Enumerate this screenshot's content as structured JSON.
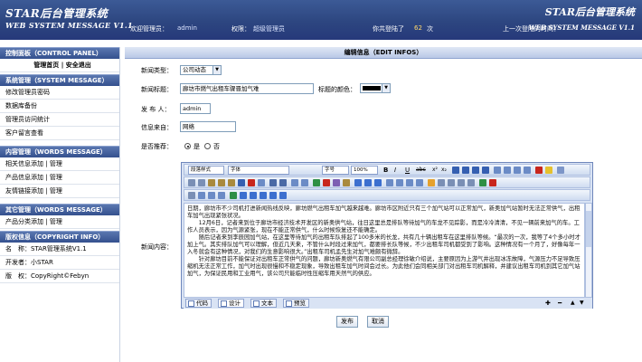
{
  "header": {
    "logo_main": "STAR后台管理系统",
    "logo_sub": "WEB SYSTEM MESSAGE V1.1",
    "logo_right": "STAR后台管理系统",
    "logo_right_sub": "WEB SYSTEM MESSAGE V1.1",
    "welcome_label": "欢迎管理员：",
    "admin_name": "admin",
    "perm_label": "权限：",
    "perm_value": "超级管理员",
    "login_count_prefix": "你共登陆了",
    "login_count": "62",
    "login_count_suffix": "次",
    "last_login_label": "上一次登陆的时间："
  },
  "sidebar": {
    "control_panel": {
      "title": "控制面板（CONTROL PANEL）",
      "home": "管理首页",
      "sep": "|",
      "logout": "安全退出"
    },
    "system": {
      "title": "系统管理（SYSTEM MESSAGE）",
      "items": [
        "修改管理员密码",
        "数据库备份",
        "管理员访问统计",
        "客户留言查看"
      ]
    },
    "content": {
      "title": "内容管理（WORDS MESSAGE）",
      "items": [
        {
          "a": "相关信息添加",
          "b": "管理"
        },
        {
          "a": "产品信息添加",
          "b": "管理"
        },
        {
          "a": "友情链接添加",
          "b": "管理"
        }
      ]
    },
    "other": {
      "title": "其它管理（WORDS MESSAGE）",
      "items": [
        {
          "a": "产品分类添加",
          "b": "管理"
        }
      ]
    },
    "copyright": {
      "title": "版权信息（COPYRIGHT INFO）",
      "name_label": "名　称：",
      "name_value": "STAR管理系统V1.1",
      "dev_label": "开发者：",
      "dev_value": "小STAR",
      "rights_label": "版　权：",
      "rights_value": "CopyRight©Febyn"
    }
  },
  "form": {
    "title": "编辑信息（EDIT INFOS）",
    "type_label": "新闻类型：",
    "type_value": "公司动态",
    "title_label": "新闻标题：",
    "title_value": "廊坊市燃气出租车骤晋加气难",
    "color_label": "标题的颜色：",
    "title_color": "#000000",
    "author_label": "发 布 人：",
    "author_value": "admin",
    "source_label": "信息来自：",
    "source_value": "网络",
    "recommend_label": "是否推荐：",
    "yes": "是",
    "no": "否",
    "recommend_selected": "yes",
    "content_label": "新闻内容：",
    "editor": {
      "style_select": "段落样式",
      "font_select": "字体",
      "size_select": "字号",
      "zoom_select": "100%",
      "paragraphs": [
        "日期，廊坊市不少司机打进新闻热线反映，廊坊燃气出租车加气越来越难。廊坊市区附近只有三个加气站可以正常加气，新奥加气站暂时无法正常供气，出租车加气出现紧张状况。",
        "　　12月6日，记者来到位于廊坊市经济技术开发区的新奥供气站，往日这里总是排队等待加气的车龙不见踪影，而是冷冷清清，不见一辆前来加气的车。工作人员表示，因为气源紧张，现在不能正常供气，什么时候恢复还不能确定。",
        "　　随后记者来到李辰园加气站，在这里等待加气的出租车队排起了100多米的长龙，共有几十辆出租车在这里排队等候。“最次的一次，我等了4个多小时才加上气。其实排队加气可以理解，但近几天来，不管什么时段过来加气，都要排长队等候，不少出租车司机都受到了影响。这种情况有一个月了，好像每年一入冬就会有这种情况，对我们的生意影响很大。”出租车司机孟先生对加气难颇有微辞。",
        "　　针对廊坊目前不能保证对出租车正常供气的问题，廊坊新奥燃气有限公司副总经理徐敏介绍说，主要原因为上游气井出现冰冻故障，气源压力不足导致压缩机无法正常工作，加气时出现很慢和不稳定现象，导致出租车加气时间会过长。为此他们会同相关部门对出租车司机解释，并建议出租车司机到其它加气站加气，为保证民用和工业用气，该公司只能临时性压缩车用天然气的供应。"
      ],
      "tab_code": "代码",
      "tab_design": "设计",
      "tab_text": "文本",
      "tab_preview": "预览"
    },
    "submit_label": "发布",
    "cancel_label": "取消"
  }
}
